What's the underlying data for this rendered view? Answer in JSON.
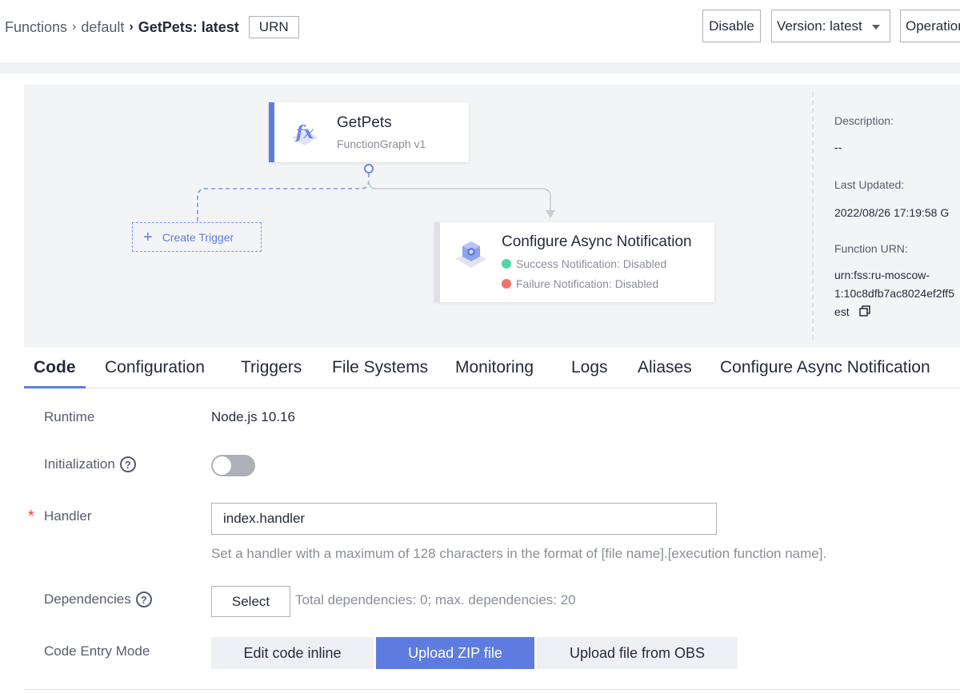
{
  "breadcrumb": {
    "root": "Functions",
    "group": "default",
    "current": "GetPets: latest",
    "urn_button": "URN"
  },
  "header_actions": {
    "disable": "Disable",
    "version": "Version: latest",
    "operations": "Operations"
  },
  "flow": {
    "function_node": {
      "title": "GetPets",
      "subtitle": "FunctionGraph v1"
    },
    "trigger_button": "Create Trigger",
    "async_node": {
      "title": "Configure Async Notification",
      "success": "Success Notification: Disabled",
      "failure": "Failure Notification: Disabled",
      "success_color": "#50d4ab",
      "failure_color": "#f66f6a"
    }
  },
  "details": {
    "description_label": "Description:",
    "description_value": "--",
    "updated_label": "Last Updated:",
    "updated_value": "2022/08/26 17:19:58 G",
    "urn_label": "Function URN:",
    "urn_line1": "urn:fss:ru-moscow-",
    "urn_line2": "1:10c8dfb7ac8024ef2ff5",
    "urn_line3": "est"
  },
  "tabs": [
    "Code",
    "Configuration",
    "Triggers",
    "File Systems",
    "Monitoring",
    "Logs",
    "Aliases",
    "Configure Async Notification"
  ],
  "form": {
    "runtime_label": "Runtime",
    "runtime_value": "Node.js 10.16",
    "init_label": "Initialization",
    "init_enabled": false,
    "handler_label": "Handler",
    "handler_value": "index.handler",
    "handler_hint": "Set a handler with a maximum of 128 characters in the format of [file name].[execution function name].",
    "deps_label": "Dependencies",
    "deps_button": "Select",
    "deps_text": "Total dependencies: 0; max. dependencies: 20",
    "entry_label": "Code Entry Mode",
    "entry_modes": [
      "Edit code inline",
      "Upload ZIP file",
      "Upload file from OBS"
    ],
    "entry_selected": "Upload ZIP file"
  },
  "colors": {
    "brand": "#5e7ce0"
  }
}
